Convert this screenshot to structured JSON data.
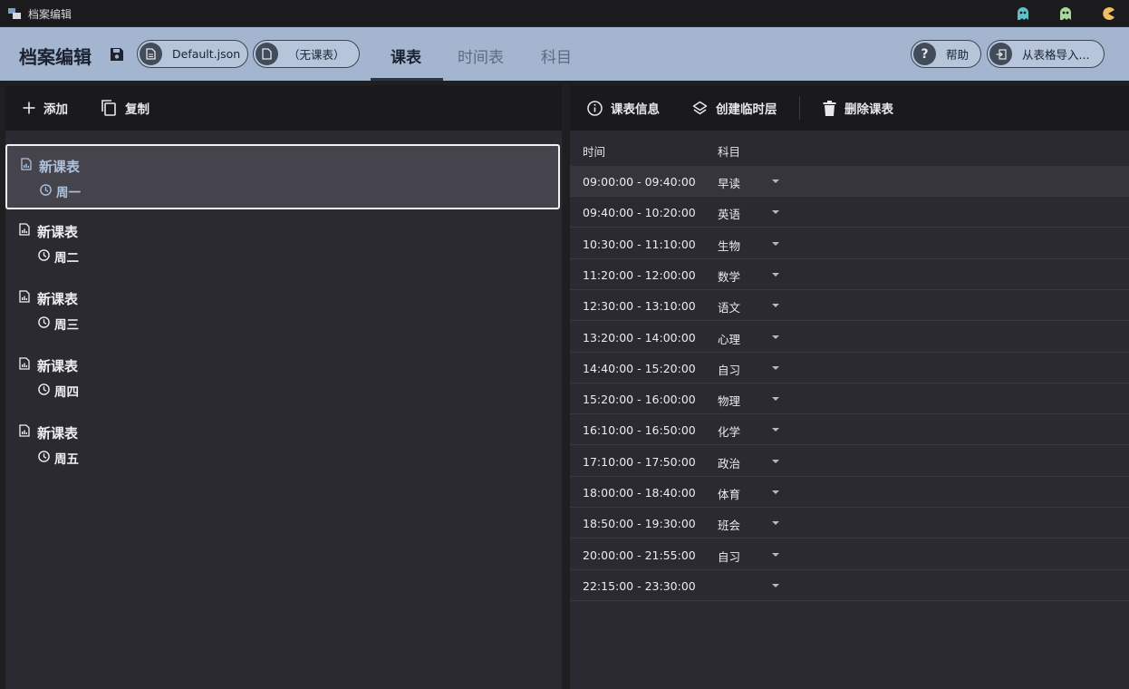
{
  "window": {
    "title": "档案编辑"
  },
  "header": {
    "app_name": "档案编辑",
    "file_pill": "Default.json",
    "schedule_pill": "（无课表）",
    "tabs": [
      {
        "label": "课表",
        "active": true
      },
      {
        "label": "时间表",
        "active": false
      },
      {
        "label": "科目",
        "active": false
      }
    ],
    "help_label": "帮助",
    "import_label": "从表格导入..."
  },
  "left_toolbar": {
    "add_label": "添加",
    "copy_label": "复制"
  },
  "schedules": [
    {
      "title": "新课表",
      "day": "周一",
      "selected": true
    },
    {
      "title": "新课表",
      "day": "周二",
      "selected": false
    },
    {
      "title": "新课表",
      "day": "周三",
      "selected": false
    },
    {
      "title": "新课表",
      "day": "周四",
      "selected": false
    },
    {
      "title": "新课表",
      "day": "周五",
      "selected": false
    }
  ],
  "right_toolbar": {
    "info_label": "课表信息",
    "temp_layer_label": "创建临时层",
    "delete_label": "删除课表"
  },
  "table": {
    "columns": [
      "时间",
      "科目"
    ],
    "rows": [
      {
        "time": "09:00:00 - 09:40:00",
        "subject": "早读"
      },
      {
        "time": "09:40:00 - 10:20:00",
        "subject": "英语"
      },
      {
        "time": "10:30:00 - 11:10:00",
        "subject": "生物"
      },
      {
        "time": "11:20:00 - 12:00:00",
        "subject": "数学"
      },
      {
        "time": "12:30:00 - 13:10:00",
        "subject": "语文"
      },
      {
        "time": "13:20:00 - 14:00:00",
        "subject": "心理"
      },
      {
        "time": "14:40:00 - 15:20:00",
        "subject": "自习"
      },
      {
        "time": "15:20:00 - 16:00:00",
        "subject": "物理"
      },
      {
        "time": "16:10:00 - 16:50:00",
        "subject": "化学"
      },
      {
        "time": "17:10:00 - 17:50:00",
        "subject": "政治"
      },
      {
        "time": "18:00:00 - 18:40:00",
        "subject": "体育"
      },
      {
        "time": "18:50:00 - 19:30:00",
        "subject": "班会"
      },
      {
        "time": "20:00:00 - 21:55:00",
        "subject": "自习"
      },
      {
        "time": "22:15:00 - 23:30:00",
        "subject": ""
      }
    ]
  },
  "colors": {
    "header_bg": "#a3b5cf",
    "panel_bg": "#2b2a30",
    "toolbar_bg": "#1a1a1c",
    "selected_text": "#aec2dd"
  }
}
